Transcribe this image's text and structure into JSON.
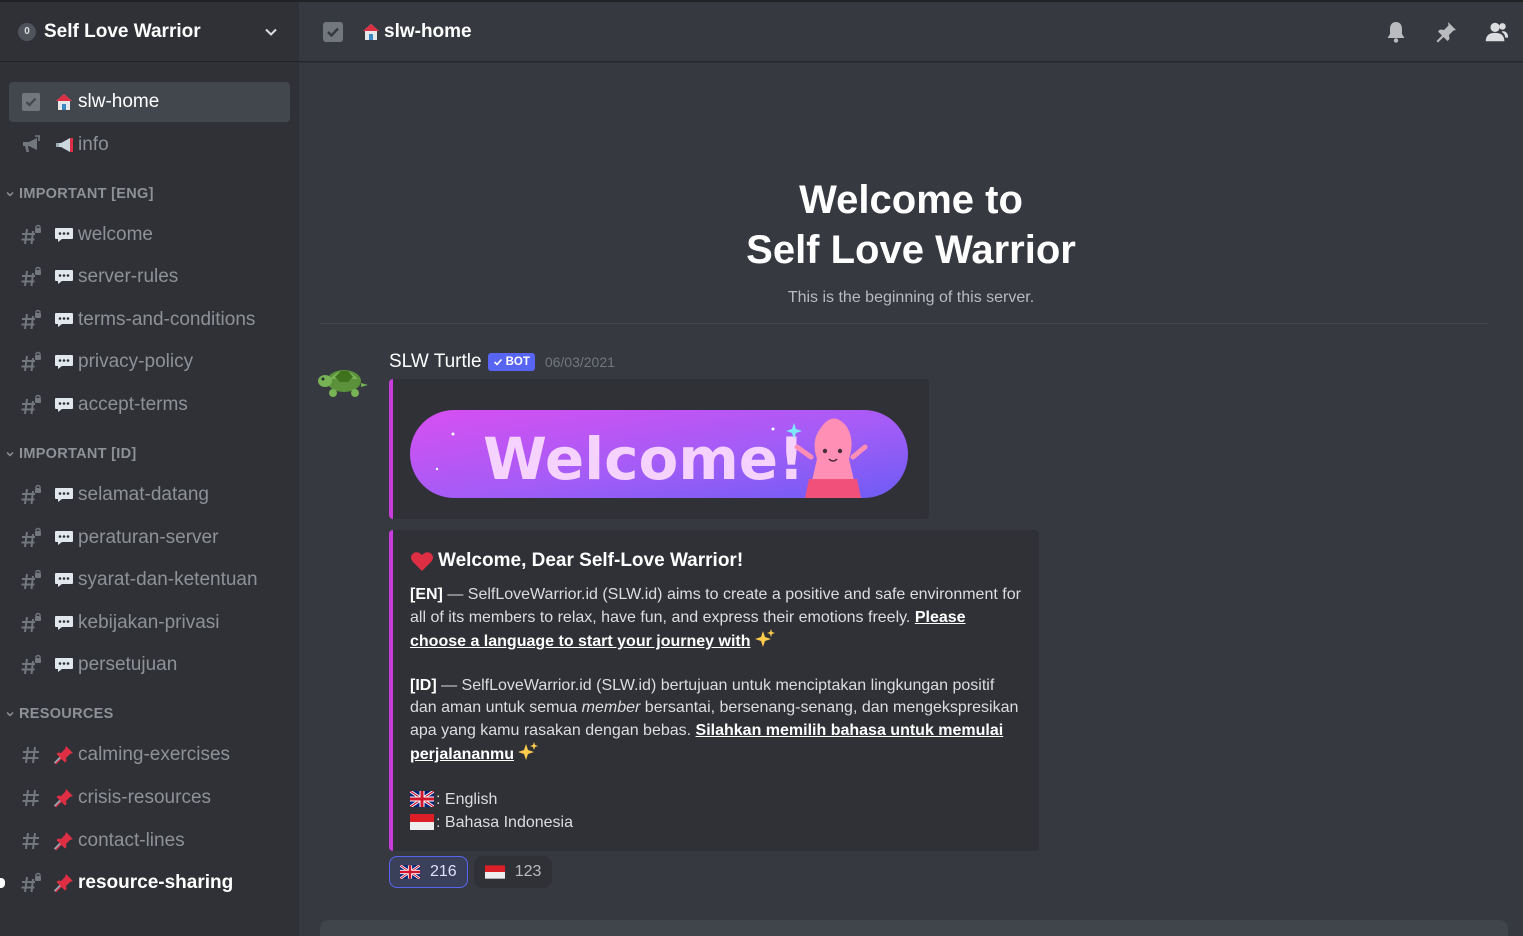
{
  "server": {
    "name": "Self Love Warrior",
    "icon_label": "0"
  },
  "sidebar": {
    "top_channels": [
      {
        "icon": "rules-checkbox-icon",
        "emoji": "house-emoji",
        "name": "slw-home",
        "selected": true
      },
      {
        "icon": "announcement-icon",
        "emoji": "loudspeaker-emoji",
        "name": "info"
      }
    ],
    "categories": [
      {
        "name": "IMPORTANT [ENG]",
        "channels": [
          {
            "icon": "locked-hash-icon",
            "emoji": "speech-bubble-emoji",
            "name": "welcome"
          },
          {
            "icon": "locked-hash-icon",
            "emoji": "speech-bubble-emoji",
            "name": "server-rules"
          },
          {
            "icon": "locked-hash-icon",
            "emoji": "speech-bubble-emoji",
            "name": "terms-and-conditions"
          },
          {
            "icon": "locked-hash-icon",
            "emoji": "speech-bubble-emoji",
            "name": "privacy-policy"
          },
          {
            "icon": "locked-hash-icon",
            "emoji": "speech-bubble-emoji",
            "name": "accept-terms"
          }
        ]
      },
      {
        "name": "IMPORTANT [ID]",
        "channels": [
          {
            "icon": "locked-hash-icon",
            "emoji": "speech-bubble-emoji",
            "name": "selamat-datang"
          },
          {
            "icon": "locked-hash-icon",
            "emoji": "speech-bubble-emoji",
            "name": "peraturan-server"
          },
          {
            "icon": "locked-hash-icon",
            "emoji": "speech-bubble-emoji",
            "name": "syarat-dan-ketentuan"
          },
          {
            "icon": "locked-hash-icon",
            "emoji": "speech-bubble-emoji",
            "name": "kebijakan-privasi"
          },
          {
            "icon": "locked-hash-icon",
            "emoji": "speech-bubble-emoji",
            "name": "persetujuan"
          }
        ]
      },
      {
        "name": "RESOURCES",
        "channels": [
          {
            "icon": "hash-icon",
            "emoji": "pushpin-emoji",
            "name": "calming-exercises"
          },
          {
            "icon": "hash-icon",
            "emoji": "pushpin-emoji",
            "name": "crisis-resources"
          },
          {
            "icon": "hash-icon",
            "emoji": "pushpin-emoji",
            "name": "contact-lines"
          },
          {
            "icon": "locked-hash-icon",
            "emoji": "pushpin-emoji",
            "name": "resource-sharing",
            "unread": true
          }
        ]
      }
    ]
  },
  "topbar": {
    "channel_name": "slw-home",
    "tools": [
      "notification-bell-icon",
      "pinned-messages-icon",
      "member-list-icon"
    ]
  },
  "welcome": {
    "line1": "Welcome to",
    "line2": "Self Love Warrior",
    "subtitle": "This is the beginning of this server."
  },
  "message": {
    "author": "SLW Turtle",
    "bot_tag": "BOT",
    "timestamp": "06/03/2021",
    "image_banner_text": "Welcome!",
    "embed": {
      "title": "Welcome, Dear Self-Love Warrior!",
      "en_tag": "[EN]",
      "en_text": " — SelfLoveWarrior.id (SLW.id) aims to create a positive and safe environment for all of its members to relax, have fun, and express their emotions freely. ",
      "en_link": "Please choose a language to start your journey with",
      "id_tag": "[ID]",
      "id_text_1": " — SelfLoveWarrior.id (SLW.id) bertujuan untuk menciptakan lingkungan positif dan aman untuk semua ",
      "id_text_em": "member",
      "id_text_2": " bersantai, bersenang-senang, dan mengekspresikan apa yang kamu rasakan dengan bebas. ",
      "id_link": "Silahkan memilih bahasa untuk memulai perjalananmu",
      "lang_en": ": English",
      "lang_id": ": Bahasa Indonesia"
    },
    "reactions": [
      {
        "emoji": "uk-flag-icon",
        "count": "216",
        "me": true
      },
      {
        "emoji": "indonesia-flag-icon",
        "count": "123",
        "me": false
      }
    ]
  },
  "colors": {
    "embed_accent": "#c73cdb",
    "bot_tag": "#5865f2",
    "background": "#36393f",
    "sidebar": "#2f3136"
  }
}
